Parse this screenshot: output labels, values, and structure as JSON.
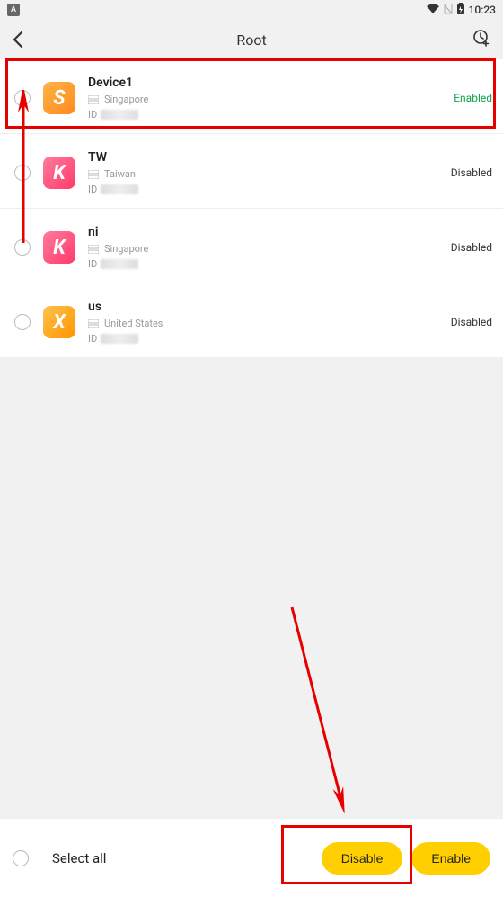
{
  "status_bar": {
    "indicator": "A",
    "time": "10:23"
  },
  "header": {
    "title": "Root"
  },
  "devices": [
    {
      "name": "Device1",
      "country": "Singapore",
      "id_label": "ID",
      "status": "Enabled",
      "status_class": "status-enabled",
      "icon_letter": "S",
      "icon_grad": "grad-orange"
    },
    {
      "name": "TW",
      "country": "Taiwan",
      "id_label": "ID",
      "status": "Disabled",
      "status_class": "status-disabled",
      "icon_letter": "K",
      "icon_grad": "grad-pink"
    },
    {
      "name": "ni",
      "country": "Singapore",
      "id_label": "ID",
      "status": "Disabled",
      "status_class": "status-disabled",
      "icon_letter": "K",
      "icon_grad": "grad-pink"
    },
    {
      "name": "us",
      "country": "United States",
      "id_label": "ID",
      "status": "Disabled",
      "status_class": "status-disabled",
      "icon_letter": "X",
      "icon_grad": "grad-orange2"
    }
  ],
  "bottom": {
    "select_all": "Select all",
    "disable": "Disable",
    "enable": "Enable"
  }
}
